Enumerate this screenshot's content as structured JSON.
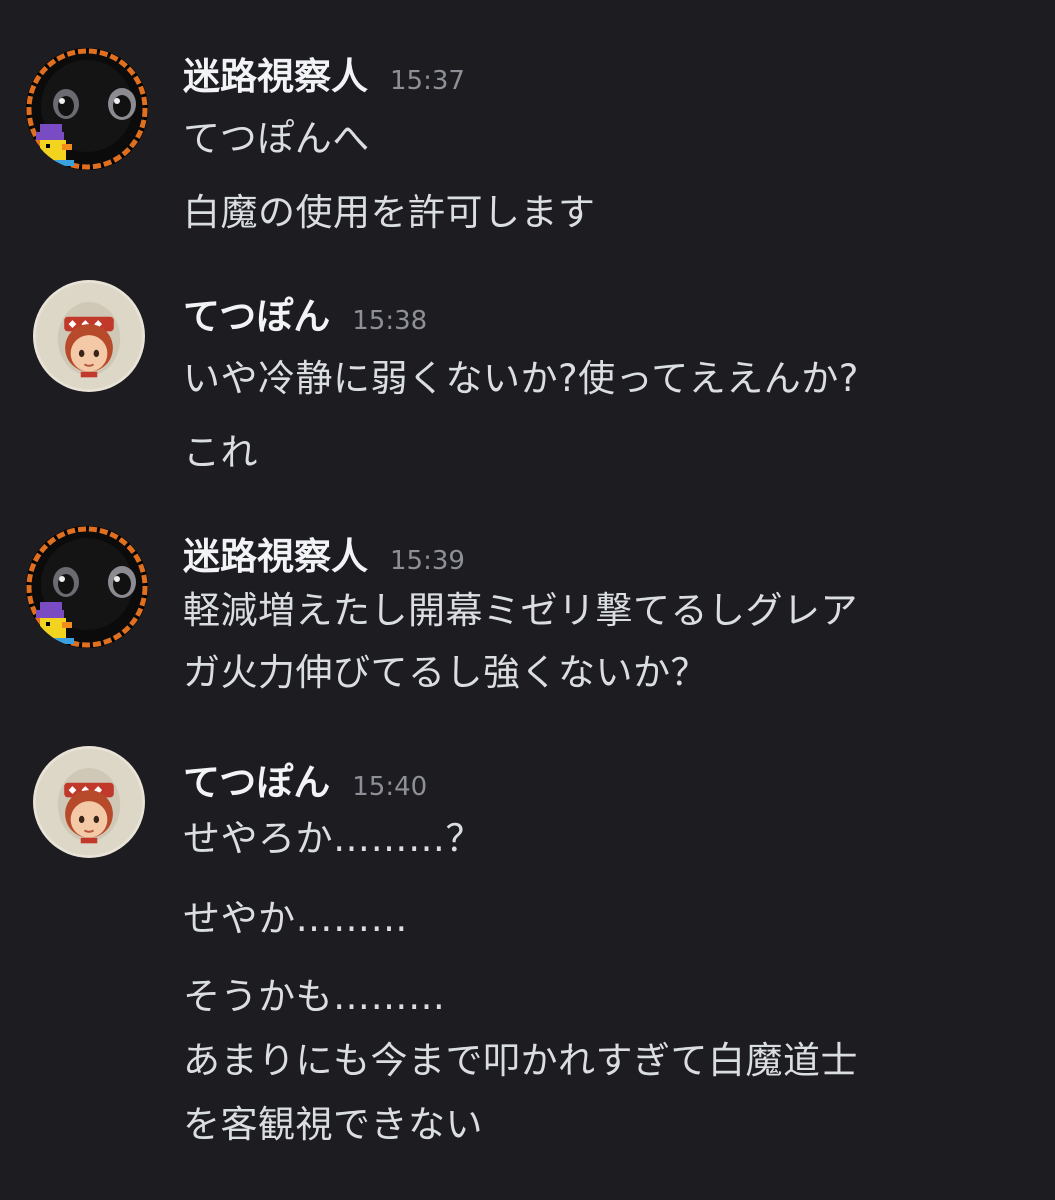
{
  "messages": [
    {
      "author": "迷路視察人",
      "time": "15:37",
      "avatar": "duck-avatar-icon",
      "lines": [
        "てつぽんへ",
        "白魔の使用を許可します"
      ]
    },
    {
      "author": "てつぽん",
      "time": "15:38",
      "avatar": "girl-avatar-icon",
      "lines": [
        "いや冷静に弱くないか?使ってええんか?",
        "これ"
      ]
    },
    {
      "author": "迷路視察人",
      "time": "15:39",
      "avatar": "duck-avatar-icon",
      "lines": [
        "軽減増えたし開幕ミゼリ撃てるしグレア",
        "ガ火力伸びてるし強くないか？"
      ]
    },
    {
      "author": "てつぽん",
      "time": "15:40",
      "avatar": "girl-avatar-icon",
      "lines": [
        "せやろか………？",
        "せやか………",
        "そうかも………",
        "あまりにも今まで叩かれすぎて白魔道士",
        "を客観視できない"
      ]
    }
  ],
  "colors": {
    "background": "#1c1c21",
    "author": "#f2f3f5",
    "text": "#dbdee1",
    "timestamp": "#8e9097"
  }
}
